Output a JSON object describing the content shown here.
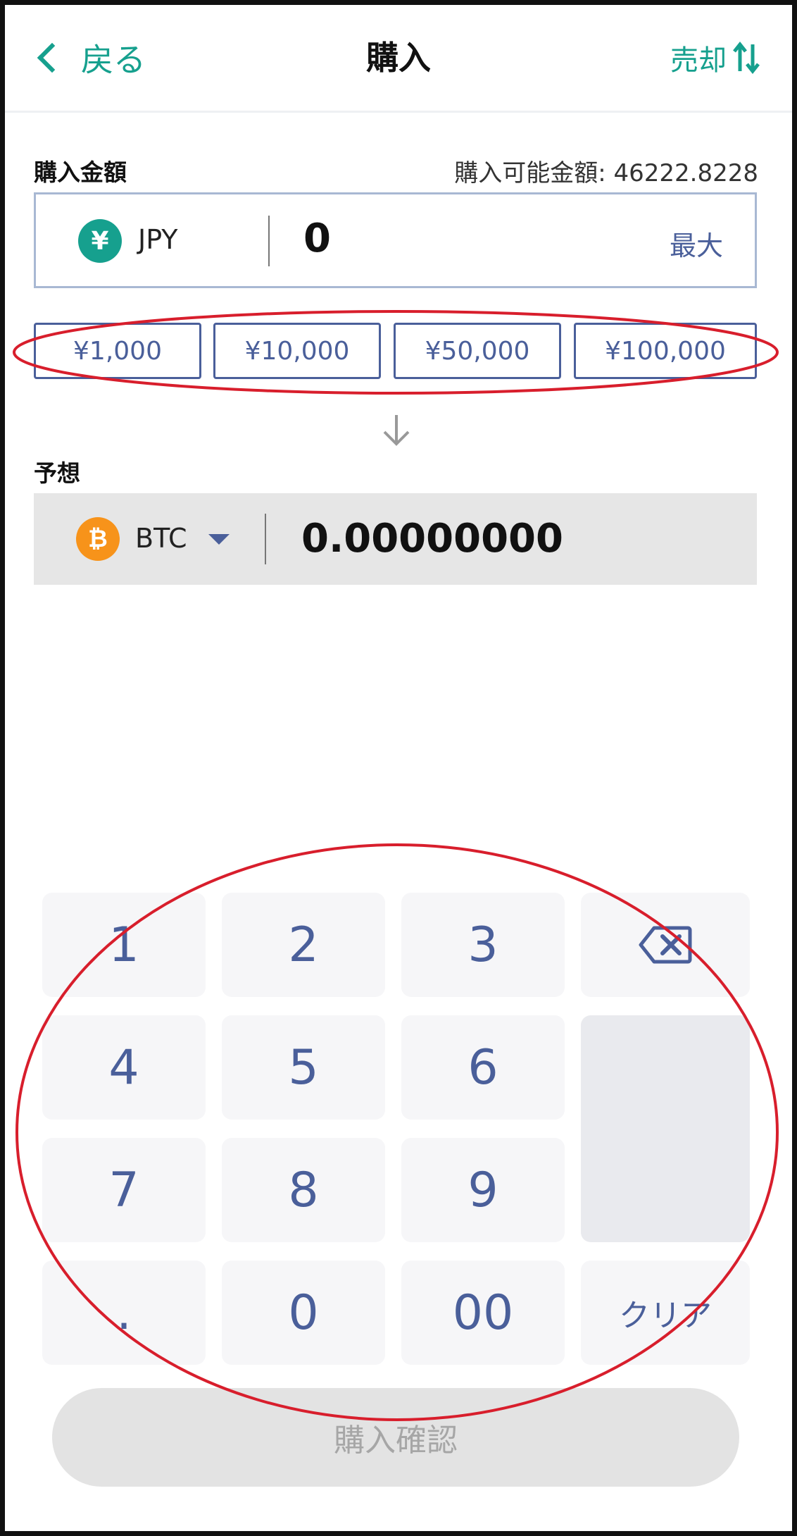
{
  "header": {
    "back_label": "戻る",
    "title": "購入",
    "sell_label": "売却"
  },
  "amount": {
    "label": "購入金額",
    "available": "購入可能金額: 46222.8228",
    "currency_symbol": "¥",
    "currency": "JPY",
    "value": "0",
    "max_label": "最大"
  },
  "presets": [
    "¥1,000",
    "¥10,000",
    "¥50,000",
    "¥100,000"
  ],
  "estimate": {
    "label": "予想",
    "currency_symbol": "₿",
    "currency": "BTC",
    "value": "0.00000000"
  },
  "keypad": {
    "k1": "1",
    "k2": "2",
    "k3": "3",
    "k4": "4",
    "k5": "5",
    "k6": "6",
    "k7": "7",
    "k8": "8",
    "k9": "9",
    "dot": ".",
    "k0": "0",
    "k00": "00",
    "clear": "クリア"
  },
  "confirm_label": "購入確認",
  "colors": {
    "accent": "#16a08e",
    "keypad_text": "#4a5f9a",
    "btc": "#f7931a",
    "annotation": "#d81e2c"
  }
}
